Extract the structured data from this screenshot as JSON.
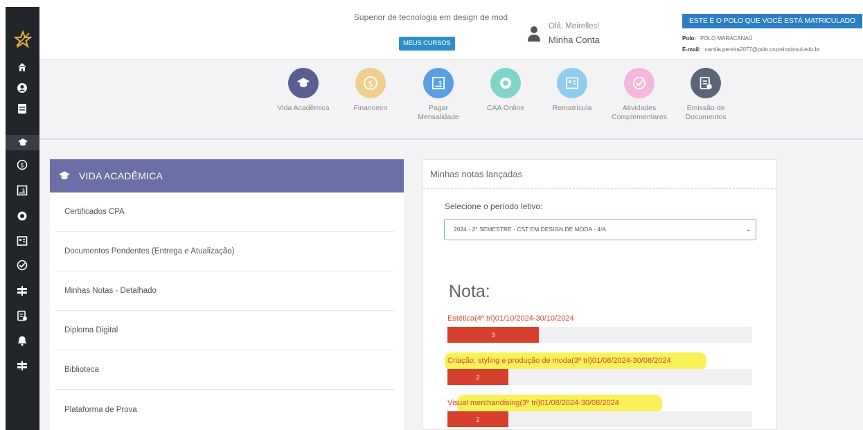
{
  "header": {
    "course_name": "Superior de tecnologia em design de mod",
    "meus_cursos_label": "MEUS CURSOS",
    "greeting": "Olá, Meirelles!",
    "account_label": "Minha Conta",
    "polo_banner": "ESTE É O POLO QUE VOCÊ ESTÁ MATRICULADO",
    "polo_label": "Polo:",
    "polo_value": "POLO MARACANAÚ",
    "email_label": "E-mail:",
    "email_value": "camila.pereira2077@polo.cruzeirodosul.edu.br"
  },
  "menu": [
    {
      "label": "Vida Acadêmica",
      "icon": "graduation-cap-icon",
      "color": "#5a5e93"
    },
    {
      "label": "Financeiro",
      "icon": "coin-icon",
      "color": "#f0cf8c"
    },
    {
      "label": "Pagar Mensalidade",
      "icon": "invoice-icon",
      "color": "#5a9fe3"
    },
    {
      "label": "CAA Online",
      "icon": "support-icon",
      "color": "#7fd6c8"
    },
    {
      "label": "Rematrícula",
      "icon": "id-card-icon",
      "color": "#8ecdf0"
    },
    {
      "label": "Atividades Complementares",
      "icon": "check-circle-icon",
      "color": "#f4b6dc"
    },
    {
      "label": "Emissão de Documentos",
      "icon": "document-icon",
      "color": "#5c6478"
    }
  ],
  "sidebar": {
    "icons": [
      "home-icon",
      "user-icon",
      "book-icon",
      "graduation-cap-icon",
      "coin-icon",
      "invoice-icon",
      "support-icon",
      "id-card-icon",
      "check-circle-icon",
      "signpost-icon",
      "document-icon",
      "bell-icon",
      "signpost-icon"
    ]
  },
  "vida_academica": {
    "title": "VIDA ACADÊMICA",
    "links": [
      "Certificados CPA",
      "Documentos Pendentes (Entrega e Atualização)",
      "Minhas Notas - Detalhado",
      "Diploma Digital",
      "Biblioteca",
      "Plataforma de Prova"
    ]
  },
  "notas": {
    "title": "Minhas notas lançadas",
    "periodo_label": "Selecione o período letivo:",
    "periodo_selected": "2024 - 2° SEMESTRE - CST EM DESIGN DE MODA - 4/A",
    "nota_heading": "Nota:",
    "grades": [
      {
        "label": "Estética(4º tri)01/10/2024-30/10/2024",
        "value": "3",
        "fraction": 0.3,
        "highlighted": false
      },
      {
        "label": "Criação, styling e produção de moda(3º tri)01/08/2024-30/08/2024",
        "value": "2",
        "fraction": 0.2,
        "highlighted": true
      },
      {
        "label": "Visual merchandising(3º tri)01/08/2024-30/08/2024",
        "value": "2",
        "fraction": 0.2,
        "highlighted": true
      }
    ]
  },
  "colors": {
    "sidebar_bg": "#22262b",
    "panel_header": "#6b6fa5",
    "grade_bar": "#d7402c",
    "highlight": "#f7ef3a",
    "button_blue": "#2d8fc9"
  }
}
